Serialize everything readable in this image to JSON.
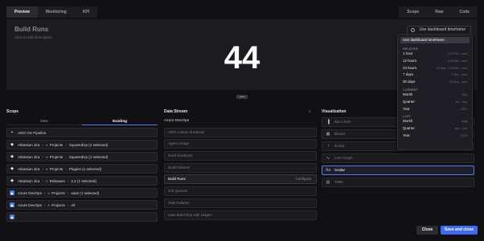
{
  "tabs_left": [
    "Preview",
    "Monitoring",
    "KPI"
  ],
  "tabs_right": [
    "Scope",
    "Raw",
    "Code"
  ],
  "preview": {
    "title": "Build Runs",
    "description": "Click to add description",
    "value": "44",
    "timeframe_button": "Use dashboard timeframe"
  },
  "dropdown": {
    "first": "Use dashboard timeframe",
    "sections": [
      {
        "title": "RELATIVE",
        "rows": [
          {
            "label": "1 hour",
            "range": "1:05 PM - now"
          },
          {
            "label": "12 hours",
            "range": "2:05 AM - now"
          },
          {
            "label": "24 hours",
            "range": "13 Sep, 2:05 PM - now"
          },
          {
            "label": "7 days",
            "range": "7 Sep - now"
          },
          {
            "label": "30 days",
            "range": "15 Aug - now"
          }
        ]
      },
      {
        "title": "CURRENT",
        "rows": [
          {
            "label": "Month",
            "range": "Sep"
          },
          {
            "label": "Quarter",
            "range": "Jul - Sep"
          },
          {
            "label": "Year",
            "range": "2020"
          }
        ]
      },
      {
        "title": "LAST",
        "rows": [
          {
            "label": "Month",
            "range": "Aug"
          },
          {
            "label": "Quarter",
            "range": "Apr - Jun"
          },
          {
            "label": "Year",
            "range": "2019"
          }
        ]
      }
    ]
  },
  "scope": {
    "title": "Scope",
    "tabs": [
      "New",
      "Existing"
    ],
    "items": [
      {
        "icon": "pipeline",
        "parts": [
          "ADO OS Pipeline"
        ]
      },
      {
        "icon": "jira",
        "parts": [
          "Atlassian Jira",
          "Projects",
          "SquaredUp (1 selected)"
        ]
      },
      {
        "icon": "jira",
        "parts": [
          "Atlassian Jira",
          "Projects",
          "SquaredUp (1 selected)"
        ]
      },
      {
        "icon": "jira",
        "parts": [
          "Atlassian Jira",
          "Projects",
          "Plugins (1 selected)"
        ]
      },
      {
        "icon": "jira",
        "parts": [
          "Atlassian Jira",
          "Releases",
          "2.2 (1 selected)"
        ]
      },
      {
        "icon": "ado",
        "parts": [
          "Azure DevOps",
          "Projects",
          "saas (1 selected)"
        ]
      },
      {
        "icon": "ado",
        "parts": [
          "Azure DevOps",
          "Projects",
          "All"
        ]
      },
      {
        "icon": "ado",
        "parts": [
          ""
        ]
      }
    ]
  },
  "datastream": {
    "title": "Data Stream",
    "org": "Azure DevOps",
    "items": [
      "ADO custom durations",
      "Agent Usage",
      "Build Durations",
      "Build Failures",
      "Build Runs",
      "Job Queues",
      "Task Failures",
      "saas Build Run with Stages"
    ],
    "active": "Build Runs",
    "configure": "Configure"
  },
  "viz": {
    "title": "Visualization",
    "items": [
      {
        "icon": "bar",
        "label": "Bar Chart"
      },
      {
        "icon": "blocks",
        "label": "Blocks"
      },
      {
        "icon": "donut",
        "label": "Donut"
      },
      {
        "icon": "line",
        "label": "Line Graph"
      },
      {
        "icon": "scalar",
        "label": "Scalar"
      },
      {
        "icon": "table",
        "label": "Table"
      }
    ],
    "active": "Scalar"
  },
  "buttons": {
    "close": "Close",
    "save": "Save and close"
  }
}
